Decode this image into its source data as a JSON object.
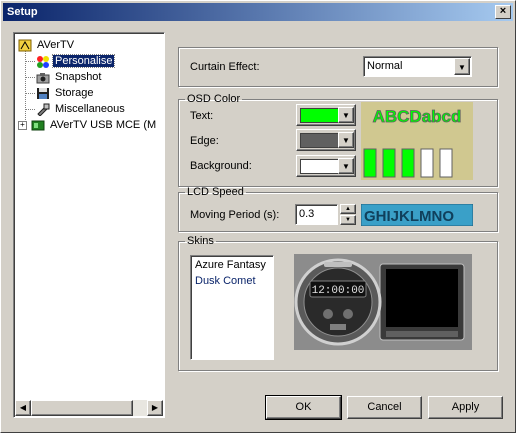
{
  "window": {
    "title": "Setup",
    "close_symbol": "×"
  },
  "tree": {
    "items": [
      {
        "label": "AVerTV",
        "icon": "avertv-icon",
        "level": 0,
        "selected": false,
        "expander": ""
      },
      {
        "label": "Personalise",
        "icon": "personalise-icon",
        "level": 1,
        "selected": true,
        "expander": ""
      },
      {
        "label": "Snapshot",
        "icon": "camera-icon",
        "level": 1,
        "selected": false,
        "expander": ""
      },
      {
        "label": "Storage",
        "icon": "floppy-disk-icon",
        "level": 1,
        "selected": false,
        "expander": ""
      },
      {
        "label": "Miscellaneous",
        "icon": "miscellaneous-icon",
        "level": 1,
        "selected": false,
        "expander": ""
      },
      {
        "label": "AVerTV USB MCE (M",
        "icon": "tv-tuner-icon",
        "level": 0,
        "selected": false,
        "expander": "+"
      }
    ]
  },
  "curtain": {
    "label": "Curtain Effect:",
    "value": "Normal"
  },
  "osd": {
    "legend": "OSD Color",
    "text_label": "Text:",
    "edge_label": "Edge:",
    "background_label": "Background:",
    "text_color": "#00ff00",
    "edge_color": "#606060",
    "background_color": "#ffffff",
    "preview_text": "ABCDabcd"
  },
  "lcd": {
    "legend": "LCD Speed",
    "label": "Moving Period (s):",
    "value": "0.3",
    "preview_text": "GHIJKLMNO"
  },
  "skins": {
    "legend": "Skins",
    "items": [
      "Azure Fantasy",
      "Dusk Comet"
    ],
    "preview_time": "12:00:00"
  },
  "buttons": {
    "ok": "OK",
    "cancel": "Cancel",
    "apply": "Apply"
  }
}
